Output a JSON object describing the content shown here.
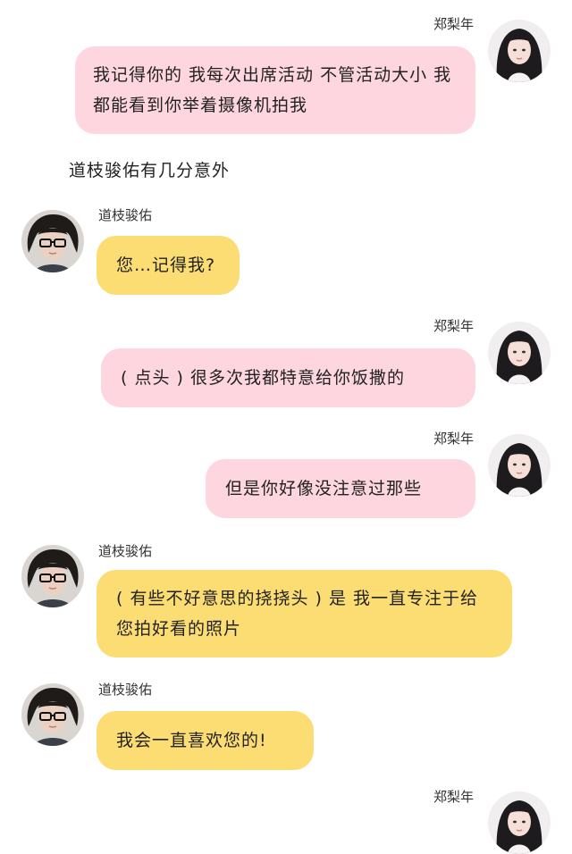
{
  "chat": {
    "m1": {
      "sender": "郑梨年",
      "text": "我记得你的 我每次出席活动 不管活动大小 我都能看到你举着摄像机拍我"
    },
    "narration": "道枝骏佑有几分意外",
    "m2": {
      "sender": "道枝骏佑",
      "text": "您…记得我?"
    },
    "m3": {
      "sender": "郑梨年",
      "text": "( 点头 ) 很多次我都特意给你饭撒的"
    },
    "m4": {
      "sender": "郑梨年",
      "text": "但是你好像没注意过那些"
    },
    "m5": {
      "sender": "道枝骏佑",
      "text": "( 有些不好意思的挠挠头 ) 是 我一直专注于给您拍好看的照片"
    },
    "m6": {
      "sender": "道枝骏佑",
      "text": "我会一直喜欢您的!"
    },
    "m7": {
      "sender": "郑梨年"
    }
  },
  "colors": {
    "pink_bubble": "#fdd6df",
    "yellow_bubble": "#fcdd73"
  }
}
